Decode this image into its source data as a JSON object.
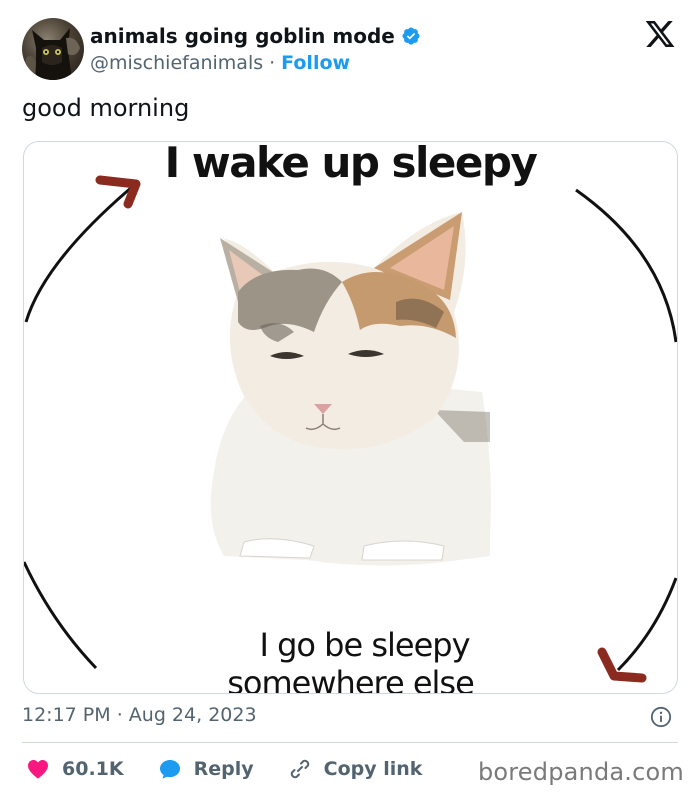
{
  "author": {
    "display_name": "animals going goblin mode",
    "handle": "@mischiefanimals",
    "separator": "·",
    "follow_label": "Follow",
    "verified": true,
    "avatar_icon": "cat-avatar"
  },
  "platform_logo": "x-logo",
  "tweet": {
    "text": "good morning"
  },
  "media": {
    "top_caption": "I wake up sleepy",
    "bottom_caption_line1": "I go be sleepy",
    "bottom_caption_line2": "somewhere else",
    "arrow_head_color": "#8b2a1e"
  },
  "meta": {
    "time": "12:17 PM",
    "separator": "·",
    "date": "Aug 24, 2023",
    "info_icon": "info-icon"
  },
  "actions": {
    "likes_count": "60.1K",
    "reply_label": "Reply",
    "copy_link_label": "Copy link"
  },
  "watermark": "boredpanda.com",
  "colors": {
    "accent": "#1d9bf0",
    "like": "#f91880",
    "text": "#0f1419",
    "muted": "#536471"
  }
}
